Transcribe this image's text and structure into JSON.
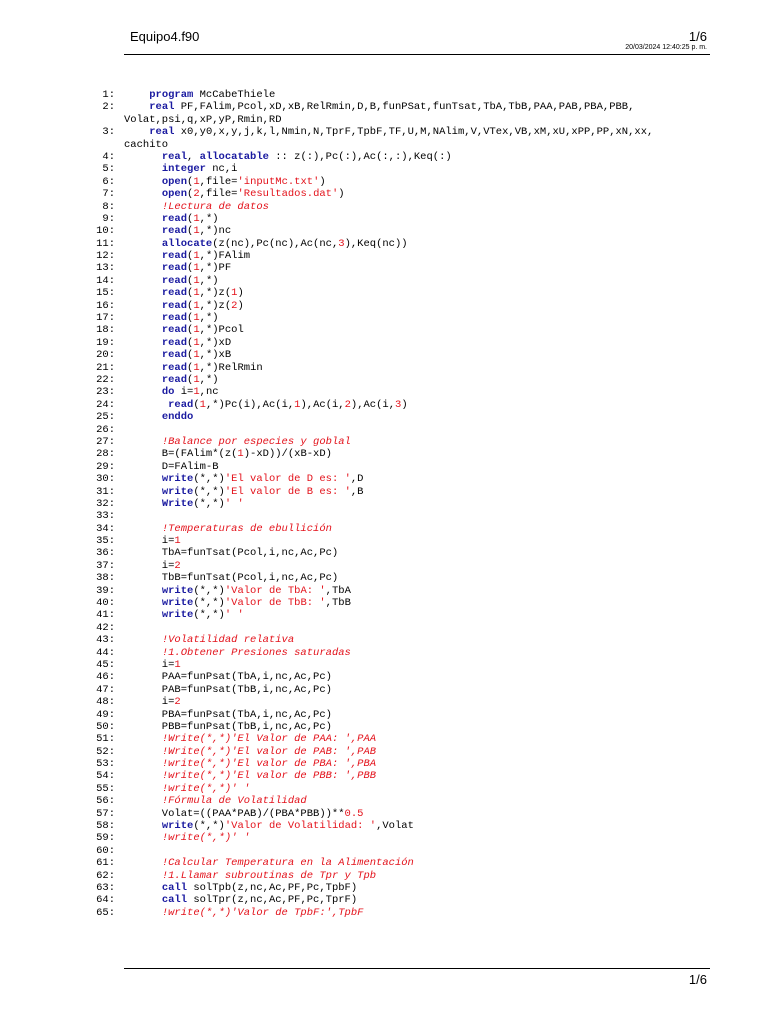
{
  "header": {
    "filename": "Equipo4.f90",
    "page": "1/6",
    "datetime": "20/03/2024 12:40:25 p. m."
  },
  "footer": {
    "page": "1/6"
  },
  "code_lines": [
    {
      "num": "1:",
      "code": "    program McCabeThiele"
    },
    {
      "num": "2:",
      "code": "    real PF,FAlim,Pcol,xD,xB,RelRmin,D,B,funPSat,funTsat,TbA,TbB,PAA,PAB,PBA,PBB,"
    },
    {
      "num": "",
      "code": "Volat,psi,q,xP,yP,Rmin,RD"
    },
    {
      "num": "3:",
      "code": "    real x0,y0,x,y,j,k,l,Nmin,N,TprF,TpbF,TF,U,M,NAlim,V,VTex,VB,xM,xU,xPP,PP,xN,xx,"
    },
    {
      "num": "",
      "code": "cachito"
    },
    {
      "num": "4:",
      "code": "      real, allocatable :: z(:),Pc(:),Ac(:,:),Keq(:)"
    },
    {
      "num": "5:",
      "code": "      integer nc,i"
    },
    {
      "num": "6:",
      "code": "      open(1,file='inputMc.txt')"
    },
    {
      "num": "7:",
      "code": "      open(2,file='Resultados.dat')"
    },
    {
      "num": "8:",
      "code": "      !Lectura de datos"
    },
    {
      "num": "9:",
      "code": "      read(1,*)"
    },
    {
      "num": "10:",
      "code": "      read(1,*)nc"
    },
    {
      "num": "11:",
      "code": "      allocate(z(nc),Pc(nc),Ac(nc,3),Keq(nc))"
    },
    {
      "num": "12:",
      "code": "      read(1,*)FAlim"
    },
    {
      "num": "13:",
      "code": "      read(1,*)PF"
    },
    {
      "num": "14:",
      "code": "      read(1,*)"
    },
    {
      "num": "15:",
      "code": "      read(1,*)z(1)"
    },
    {
      "num": "16:",
      "code": "      read(1,*)z(2)"
    },
    {
      "num": "17:",
      "code": "      read(1,*)"
    },
    {
      "num": "18:",
      "code": "      read(1,*)Pcol"
    },
    {
      "num": "19:",
      "code": "      read(1,*)xD"
    },
    {
      "num": "20:",
      "code": "      read(1,*)xB"
    },
    {
      "num": "21:",
      "code": "      read(1,*)RelRmin"
    },
    {
      "num": "22:",
      "code": "      read(1,*)"
    },
    {
      "num": "23:",
      "code": "      do i=1,nc"
    },
    {
      "num": "24:",
      "code": "       read(1,*)Pc(i),Ac(i,1),Ac(i,2),Ac(i,3)"
    },
    {
      "num": "25:",
      "code": "      enddo"
    },
    {
      "num": "26:",
      "code": ""
    },
    {
      "num": "27:",
      "code": "      !Balance por especies y goblal"
    },
    {
      "num": "28:",
      "code": "      B=(FAlim*(z(1)-xD))/(xB-xD)"
    },
    {
      "num": "29:",
      "code": "      D=FAlim-B"
    },
    {
      "num": "30:",
      "code": "      write(*,*)'El valor de D es: ',D"
    },
    {
      "num": "31:",
      "code": "      write(*,*)'El valor de B es: ',B"
    },
    {
      "num": "32:",
      "code": "      Write(*,*)' '"
    },
    {
      "num": "33:",
      "code": ""
    },
    {
      "num": "34:",
      "code": "      !Temperaturas de ebullición"
    },
    {
      "num": "35:",
      "code": "      i=1"
    },
    {
      "num": "36:",
      "code": "      TbA=funTsat(Pcol,i,nc,Ac,Pc)"
    },
    {
      "num": "37:",
      "code": "      i=2"
    },
    {
      "num": "38:",
      "code": "      TbB=funTsat(Pcol,i,nc,Ac,Pc)"
    },
    {
      "num": "39:",
      "code": "      write(*,*)'Valor de TbA: ',TbA"
    },
    {
      "num": "40:",
      "code": "      write(*,*)'Valor de TbB: ',TbB"
    },
    {
      "num": "41:",
      "code": "      write(*,*)' '"
    },
    {
      "num": "42:",
      "code": ""
    },
    {
      "num": "43:",
      "code": "      !Volatilidad relativa"
    },
    {
      "num": "44:",
      "code": "      !1.Obtener Presiones saturadas"
    },
    {
      "num": "45:",
      "code": "      i=1"
    },
    {
      "num": "46:",
      "code": "      PAA=funPsat(TbA,i,nc,Ac,Pc)"
    },
    {
      "num": "47:",
      "code": "      PAB=funPsat(TbB,i,nc,Ac,Pc)"
    },
    {
      "num": "48:",
      "code": "      i=2"
    },
    {
      "num": "49:",
      "code": "      PBA=funPsat(TbA,i,nc,Ac,Pc)"
    },
    {
      "num": "50:",
      "code": "      PBB=funPsat(TbB,i,nc,Ac,Pc)"
    },
    {
      "num": "51:",
      "code": "      !Write(*,*)'El Valor de PAA: ',PAA"
    },
    {
      "num": "52:",
      "code": "      !Write(*,*)'El valor de PAB: ',PAB"
    },
    {
      "num": "53:",
      "code": "      !write(*,*)'El valor de PBA: ',PBA"
    },
    {
      "num": "54:",
      "code": "      !write(*,*)'El valor de PBB: ',PBB"
    },
    {
      "num": "55:",
      "code": "      !write(*,*)' '"
    },
    {
      "num": "56:",
      "code": "      !Fórmula de Volatilidad"
    },
    {
      "num": "57:",
      "code": "      Volat=((PAA*PAB)/(PBA*PBB))**0.5"
    },
    {
      "num": "58:",
      "code": "      write(*,*)'Valor de Volatilidad: ',Volat"
    },
    {
      "num": "59:",
      "code": "      !write(*,*)' '"
    },
    {
      "num": "60:",
      "code": ""
    },
    {
      "num": "61:",
      "code": "      !Calcular Temperatura en la Alimentación"
    },
    {
      "num": "62:",
      "code": "      !1.Llamar subroutinas de Tpr y Tpb"
    },
    {
      "num": "63:",
      "code": "      call solTpb(z,nc,Ac,PF,Pc,TpbF)"
    },
    {
      "num": "64:",
      "code": "      call solTpr(z,nc,Ac,PF,Pc,TprF)"
    },
    {
      "num": "65:",
      "code": "      !write(*,*)'Valor de TpbF:',TpbF"
    }
  ]
}
